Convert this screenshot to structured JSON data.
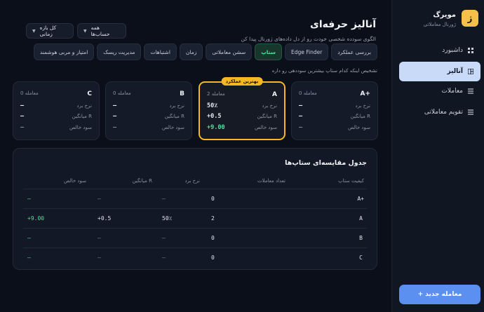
{
  "sidebar": {
    "brand_name": "مویرگ",
    "brand_sub": "ژورنال معاملاتی",
    "brand_logo": "ژ",
    "items": [
      {
        "label": "داشبورد",
        "icon": "dashboard-icon",
        "active": false
      },
      {
        "label": "آنالیز",
        "icon": "analysis-icon",
        "active": true
      },
      {
        "label": "معاملات",
        "icon": "trades-icon",
        "active": false
      },
      {
        "label": "تقویم معاملاتی",
        "icon": "calendar-icon",
        "active": false
      }
    ],
    "new_trade": "+ معامله جدید"
  },
  "header": {
    "title": "آنالیز حرفه‌ای",
    "subtitle": "الگوی سودده شخصی خودت رو از دل داده‌های ژورنال پیدا کن",
    "filter_accounts": "همه حساب‌ها",
    "filter_period": "کل بازه زمانی"
  },
  "tabs": [
    {
      "label": "بررسی عملکرد",
      "active": false
    },
    {
      "label": "Edge Finder",
      "active": false
    },
    {
      "label": "ستاپ",
      "active": true
    },
    {
      "label": "سشن معاملاتی",
      "active": false
    },
    {
      "label": "زمان",
      "active": false
    },
    {
      "label": "اشتباهات",
      "active": false
    },
    {
      "label": "مدیریت ریسک",
      "active": false
    },
    {
      "label": "امتیاز و مربی هوشمند",
      "active": false
    }
  ],
  "hint": "تشخیص اینکه کدام ستاپ بیشترین سوددهی رو داره",
  "labels": {
    "win_rate": "نرخ برد",
    "avg_r": "میانگین R",
    "net_profit": "سود خالص",
    "best_badge": "بهترین عملکرد"
  },
  "cards": [
    {
      "name": "A+",
      "count": "0 معامله",
      "win_rate": "—",
      "avg_r": "—",
      "net": "—"
    },
    {
      "name": "A",
      "count": "2 معامله",
      "win_rate": "50٪",
      "avg_r": "+0.5",
      "net": "+9.00"
    },
    {
      "name": "B",
      "count": "0 معامله",
      "win_rate": "—",
      "avg_r": "—",
      "net": "—"
    },
    {
      "name": "C",
      "count": "0 معامله",
      "win_rate": "—",
      "avg_r": "—",
      "net": "—"
    }
  ],
  "table": {
    "title": "جدول مقایسه‌ای ستاپ‌ها",
    "headers": [
      "کیفیت ستاپ",
      "تعداد معاملات",
      "نرخ برد",
      "میانگین R",
      "سود خالص"
    ],
    "rows": [
      {
        "setup": "A+",
        "count": "0",
        "win_rate": "—",
        "avg_r": "—",
        "net": "—"
      },
      {
        "setup": "A",
        "count": "2",
        "win_rate": "50٪",
        "avg_r": "+0.5",
        "net": "+9.00"
      },
      {
        "setup": "B",
        "count": "0",
        "win_rate": "—",
        "avg_r": "—",
        "net": "—"
      },
      {
        "setup": "C",
        "count": "0",
        "win_rate": "—",
        "avg_r": "—",
        "net": "—"
      }
    ]
  },
  "colors": {
    "accent_green": "#4ee09a",
    "highlight_gold": "#f5b823",
    "primary_blue": "#5b8ff0"
  }
}
